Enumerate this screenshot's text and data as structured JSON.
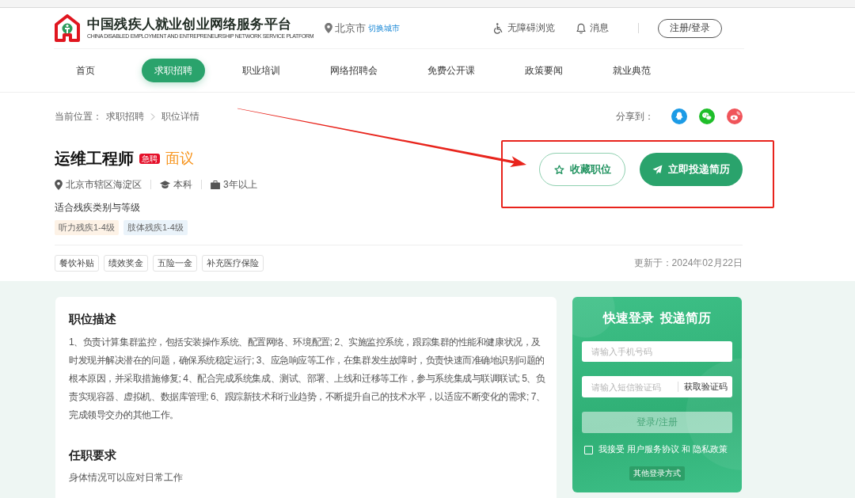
{
  "header": {
    "site_title": "中国残疾人就业创业网络服务平台",
    "site_subtitle": "CHINA DISABLED EMPLOYMENT AND ENTREPRENEURSHIP NETWORK SERVICE PLATFORM",
    "city": "北京市",
    "switch_city": "切换城市",
    "accessibility": "无障碍浏览",
    "messages": "消息",
    "login_button": "注册/登录"
  },
  "nav": [
    {
      "label": "首页",
      "selected": false
    },
    {
      "label": "求职招聘",
      "selected": true
    },
    {
      "label": "职业培训",
      "selected": false
    },
    {
      "label": "网络招聘会",
      "selected": false
    },
    {
      "label": "免费公开课",
      "selected": false
    },
    {
      "label": "政策要闻",
      "selected": false
    },
    {
      "label": "就业典范",
      "selected": false
    }
  ],
  "breadcrumb": {
    "label": "当前位置：",
    "items": [
      "求职招聘",
      "职位详情"
    ]
  },
  "share": {
    "label": "分享到："
  },
  "job": {
    "title": "运维工程师",
    "badge": "急聘",
    "salary": "面议",
    "location": "北京市辖区海淀区",
    "education": "本科",
    "experience": "3年以上",
    "disability_heading": "适合残疾类别与等级",
    "disability_tags": [
      {
        "label": "听力残疾1-4级",
        "color": "#fdf2e6"
      },
      {
        "label": "肢体残疾1-4级",
        "color": "#eaf3fa"
      }
    ],
    "buttons": [
      {
        "label": "收藏职位",
        "kind": "outline"
      },
      {
        "label": "立即投递简历",
        "kind": "primary"
      }
    ],
    "benefits": [
      "餐饮补贴",
      "绩效奖金",
      "五险一金",
      "补充医疗保险"
    ],
    "updated": "更新于：2024年02月22日"
  },
  "description": {
    "heading": "职位描述",
    "text": "1、负责计算集群监控，包括安装操作系统、配置网络、环境配置; 2、实施监控系统，跟踪集群的性能和健康状况，及时发现并解决潜在的问题，确保系统稳定运行; 3、应急响应等工作，在集群发生故障时，负责快速而准确地识别问题的根本原因，并采取措施修复; 4、配合完成系统集成、测试、部署、上线和迁移等工作，参与系统集成与联调联试; 5、负责实现容器、虚拟机、数据库管理; 6、跟踪新技术和行业趋势，不断提升自己的技术水平，以适应不断变化的需求; 7、完成领导交办的其他工作。"
  },
  "requirements": {
    "heading": "任职要求",
    "text": "身体情况可以应对日常工作"
  },
  "login_panel": {
    "title": "快速登录  投递简历",
    "phone_placeholder": "请输入手机号码",
    "code_placeholder": "请输入短信验证码",
    "get_code": "获取验证码",
    "submit": "登录/注册",
    "agree_checked": false,
    "agreement": "我接受 用户服务协议 和 隐私政策",
    "other_login": "其他登录方式"
  }
}
